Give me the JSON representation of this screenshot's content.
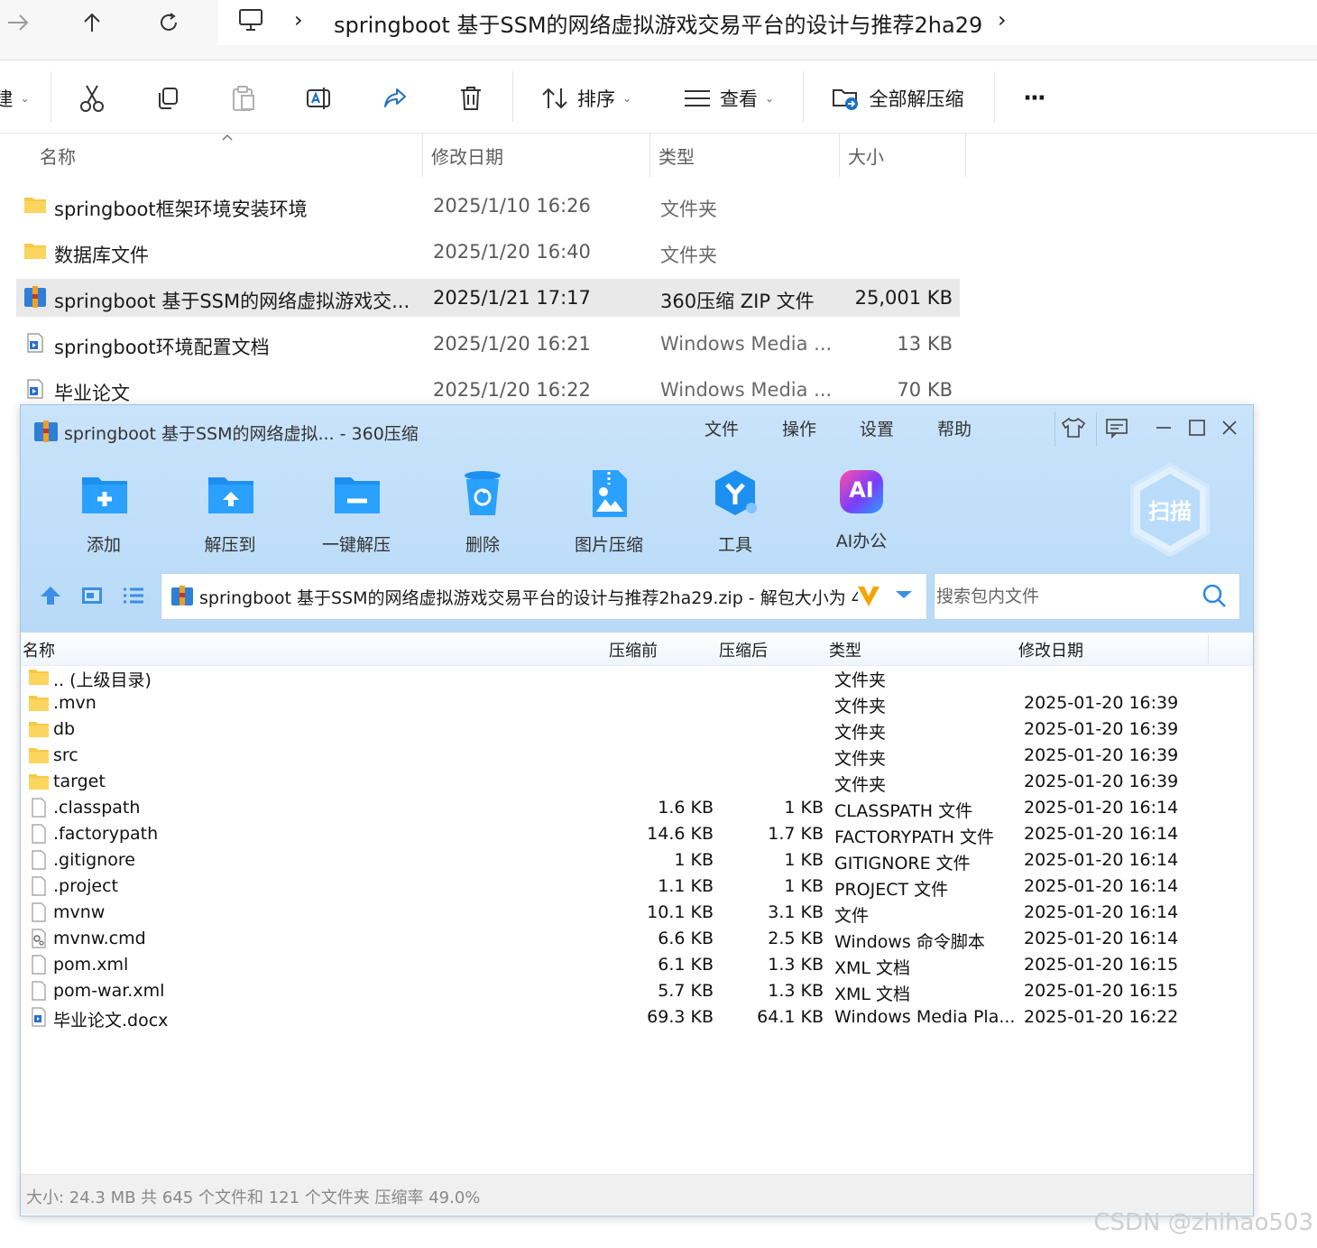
{
  "explorer": {
    "breadcrumb": {
      "sep1": "›",
      "folder": "springboot 基于SSM的网络虚拟游戏交易平台的设计与推荐2ha29",
      "sep2": "›"
    },
    "toolbar": {
      "new_partial": "建",
      "sort_label": "排序",
      "view_label": "查看",
      "extract_all_label": "全部解压缩",
      "more_label": "···"
    },
    "columns": {
      "name": "名称",
      "date": "修改日期",
      "type": "类型",
      "size": "大小"
    },
    "rows": [
      {
        "name": "springboot框架环境安装环境",
        "date": "2025/1/10 16:26",
        "type": "文件夹",
        "size": "",
        "icon": "folder-icon"
      },
      {
        "name": "数据库文件",
        "date": "2025/1/20 16:40",
        "type": "文件夹",
        "size": "",
        "icon": "folder-icon"
      },
      {
        "name": "springboot 基于SSM的网络虚拟游戏交...",
        "date": "2025/1/21 17:17",
        "type": "360压缩 ZIP 文件",
        "size": "25,001 KB",
        "icon": "zip-archive-icon"
      },
      {
        "name": "springboot环境配置文档",
        "date": "2025/1/20 16:21",
        "type": "Windows Media ...",
        "size": "13 KB",
        "icon": "media-file-icon"
      },
      {
        "name": "毕业论文",
        "date": "2025/1/20 16:22",
        "type": "Windows Media ...",
        "size": "70 KB",
        "icon": "media-file-icon"
      }
    ]
  },
  "zip": {
    "title": "springboot 基于SSM的网络虚拟... - 360压缩",
    "menu": [
      "文件",
      "操作",
      "设置",
      "帮助"
    ],
    "tools": [
      {
        "label": "添加",
        "icon": "add-icon"
      },
      {
        "label": "解压到",
        "icon": "extract-to-icon"
      },
      {
        "label": "一键解压",
        "icon": "one-click-extract-icon"
      },
      {
        "label": "删除",
        "icon": "delete-icon"
      },
      {
        "label": "图片压缩",
        "icon": "image-compress-icon"
      },
      {
        "label": "工具",
        "icon": "tools-icon"
      },
      {
        "label": "AI办公",
        "icon": "ai-office-icon"
      }
    ],
    "scan_label": "扫描",
    "ai_badge": "AI",
    "path": "springboot 基于SSM的网络虚拟游戏交易平台的设计与推荐2ha29.zip - 解包大小为 4",
    "search_placeholder": "搜索包内文件",
    "columns": {
      "name": "名称",
      "before": "压缩前",
      "after": "压缩后",
      "type": "类型",
      "date": "修改日期"
    },
    "rows": [
      {
        "name": ".. (上级目录)",
        "before": "",
        "after": "",
        "type": "文件夹",
        "date": "",
        "icon": "folder-icon"
      },
      {
        "name": ".mvn",
        "before": "",
        "after": "",
        "type": "文件夹",
        "date": "2025-01-20 16:39",
        "icon": "folder-icon"
      },
      {
        "name": "db",
        "before": "",
        "after": "",
        "type": "文件夹",
        "date": "2025-01-20 16:39",
        "icon": "folder-icon"
      },
      {
        "name": "src",
        "before": "",
        "after": "",
        "type": "文件夹",
        "date": "2025-01-20 16:39",
        "icon": "folder-icon"
      },
      {
        "name": "target",
        "before": "",
        "after": "",
        "type": "文件夹",
        "date": "2025-01-20 16:39",
        "icon": "folder-icon"
      },
      {
        "name": ".classpath",
        "before": "1.6 KB",
        "after": "1 KB",
        "type": "CLASSPATH 文件",
        "date": "2025-01-20 16:14",
        "icon": "file-icon"
      },
      {
        "name": ".factorypath",
        "before": "14.6 KB",
        "after": "1.7 KB",
        "type": "FACTORYPATH 文件",
        "date": "2025-01-20 16:14",
        "icon": "file-icon"
      },
      {
        "name": ".gitignore",
        "before": "1 KB",
        "after": "1 KB",
        "type": "GITIGNORE 文件",
        "date": "2025-01-20 16:14",
        "icon": "file-icon"
      },
      {
        "name": ".project",
        "before": "1.1 KB",
        "after": "1 KB",
        "type": "PROJECT 文件",
        "date": "2025-01-20 16:14",
        "icon": "file-icon"
      },
      {
        "name": "mvnw",
        "before": "10.1 KB",
        "after": "3.1 KB",
        "type": "文件",
        "date": "2025-01-20 16:14",
        "icon": "file-icon"
      },
      {
        "name": "mvnw.cmd",
        "before": "6.6 KB",
        "after": "2.5 KB",
        "type": "Windows 命令脚本",
        "date": "2025-01-20 16:14",
        "icon": "script-file-icon"
      },
      {
        "name": "pom.xml",
        "before": "6.1 KB",
        "after": "1.3 KB",
        "type": "XML 文档",
        "date": "2025-01-20 16:15",
        "icon": "file-icon"
      },
      {
        "name": "pom-war.xml",
        "before": "5.7 KB",
        "after": "1.3 KB",
        "type": "XML 文档",
        "date": "2025-01-20 16:15",
        "icon": "file-icon"
      },
      {
        "name": "毕业论文.docx",
        "before": "69.3 KB",
        "after": "64.1 KB",
        "type": "Windows Media Pla...",
        "date": "2025-01-20 16:22",
        "icon": "media-file-icon"
      }
    ],
    "status": "大小: 24.3 MB 共 645 个文件和 121 个文件夹 压缩率 49.0%"
  },
  "watermark": "CSDN @zhihao503"
}
